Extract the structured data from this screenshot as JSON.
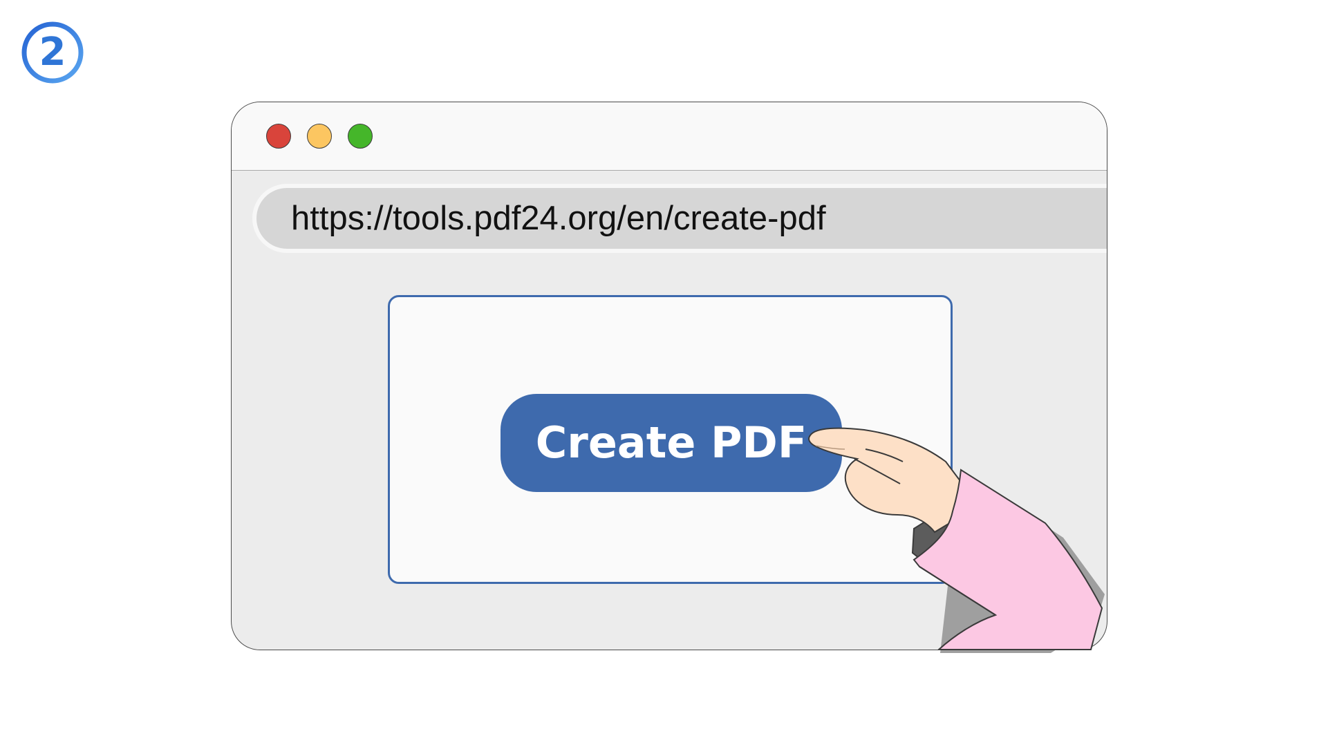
{
  "step": {
    "number": "2"
  },
  "browser": {
    "url": "https://tools.pdf24.org/en/create-pdf",
    "window_controls": [
      "close",
      "minimize",
      "maximize"
    ]
  },
  "main": {
    "create_button_label": "Create PDF"
  },
  "colors": {
    "accent_blue": "#3e6aad",
    "badge_blue": "#2f75d6",
    "close": "#d9443b",
    "minimize": "#fcc661",
    "maximize": "#45b62a",
    "sleeve_pink": "#fcc8e3",
    "skin": "#fde0c7"
  },
  "icons": {
    "step_badge": "circled-number-icon",
    "pointer": "pointing-hand-icon"
  }
}
